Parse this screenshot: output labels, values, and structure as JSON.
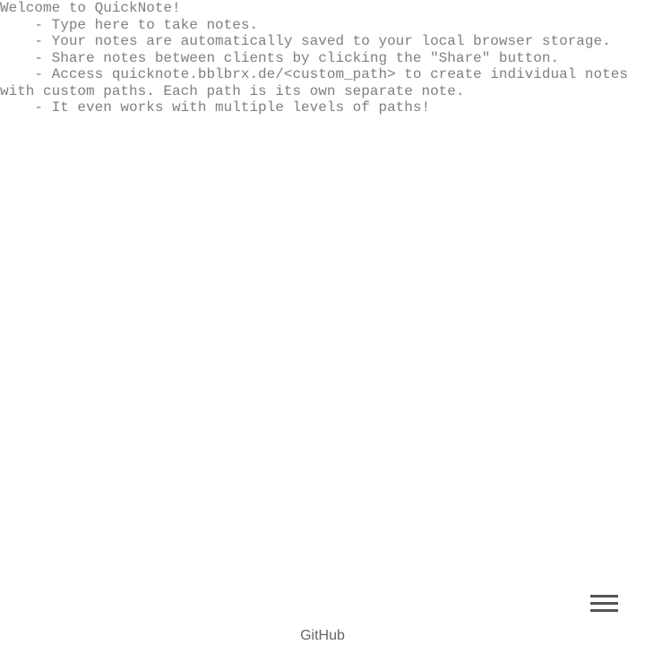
{
  "note": {
    "text": "Welcome to QuickNote!\n    - Type here to take notes.\n    - Your notes are automatically saved to your local browser storage.\n    - Share notes between clients by clicking the \"Share\" button.\n    - Access quicknote.bblbrx.de/<custom_path> to create individual notes with custom paths. Each path is its own separate note.\n    - It even works with multiple levels of paths!"
  },
  "menu": {
    "icon": "hamburger-menu-icon"
  },
  "footer": {
    "link_label": "GitHub"
  },
  "colors": {
    "note_text": "#808080",
    "menu_icon": "#555555",
    "footer_text": "#666666",
    "background": "#ffffff"
  }
}
